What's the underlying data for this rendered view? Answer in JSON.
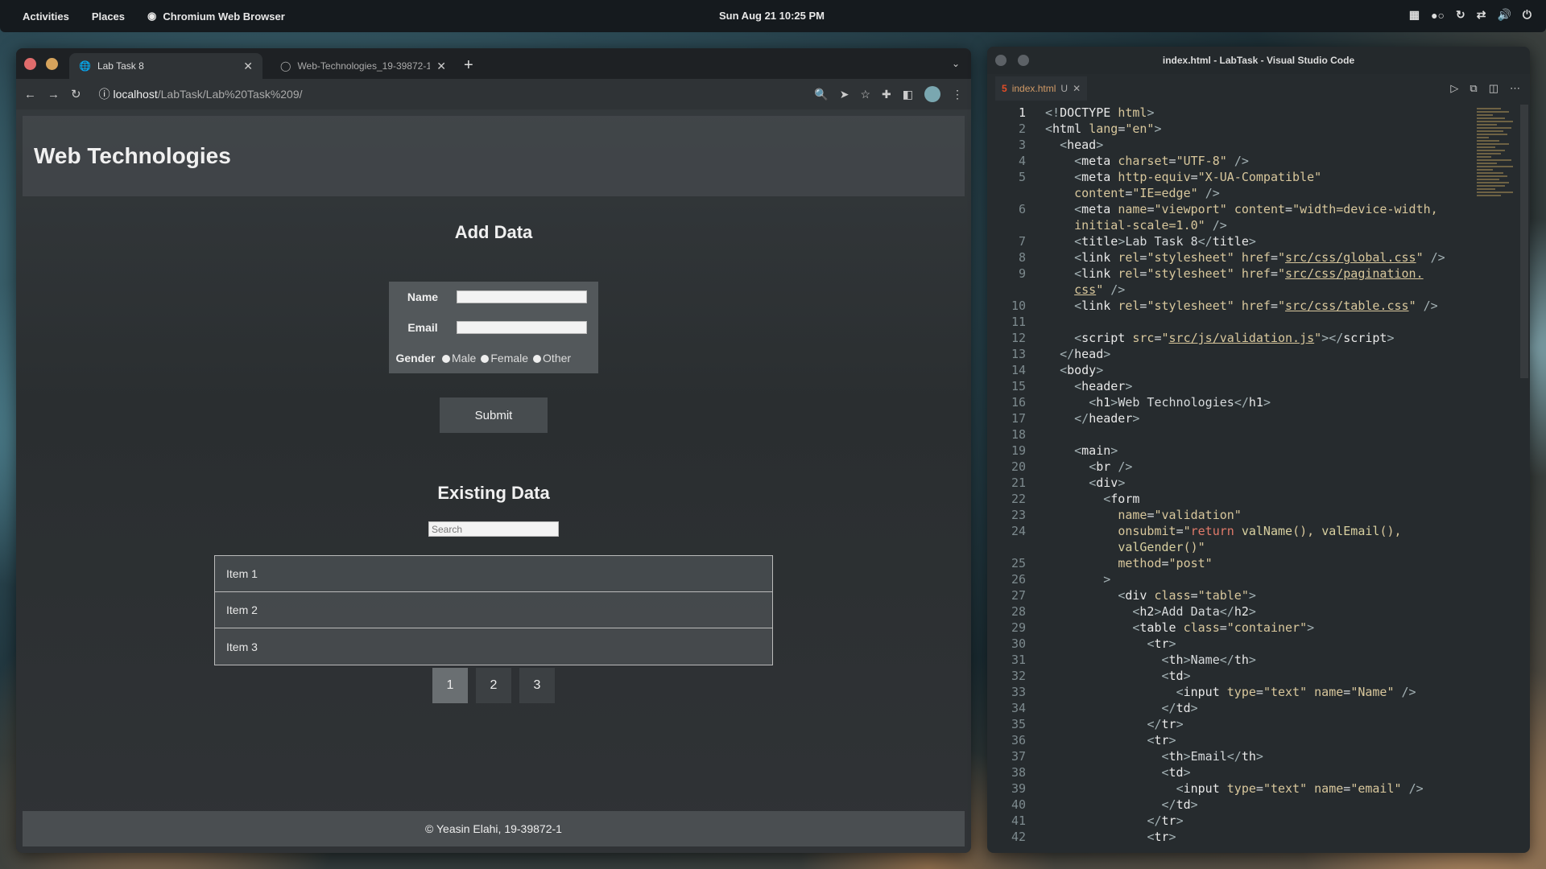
{
  "topbar": {
    "activities": "Activities",
    "places": "Places",
    "app_name": "Chromium Web Browser",
    "clock": "Sun Aug 21  10:25 PM"
  },
  "browser": {
    "tabs": [
      {
        "title": "Lab Task 8",
        "active": true
      },
      {
        "title": "Web-Technologies_19-39872-1/...",
        "active": false
      }
    ],
    "url_host": "localhost",
    "url_path": "/LabTask/Lab%20Task%209/"
  },
  "page": {
    "header_title": "Web Technologies",
    "add_title": "Add Data",
    "form": {
      "name_label": "Name",
      "email_label": "Email",
      "gender_label": "Gender",
      "gender_options": [
        "Male",
        "Female",
        "Other"
      ],
      "submit_label": "Submit"
    },
    "existing_title": "Existing Data",
    "search_placeholder": "Search",
    "items": [
      "Item 1",
      "Item 2",
      "Item 3"
    ],
    "pages": [
      "1",
      "2",
      "3"
    ],
    "active_page": "1",
    "footer": "© Yeasin Elahi, 19-39872-1"
  },
  "vscode": {
    "title": "index.html - LabTask - Visual Studio Code",
    "tab_name": "index.html",
    "tab_badge": "U"
  },
  "colors": {
    "topbar_bg": "#151a1e",
    "page_bg": "#2f3336",
    "accent_html": "#e44d26",
    "window_close": "#e06c6c",
    "window_min": "#d6a35c"
  }
}
